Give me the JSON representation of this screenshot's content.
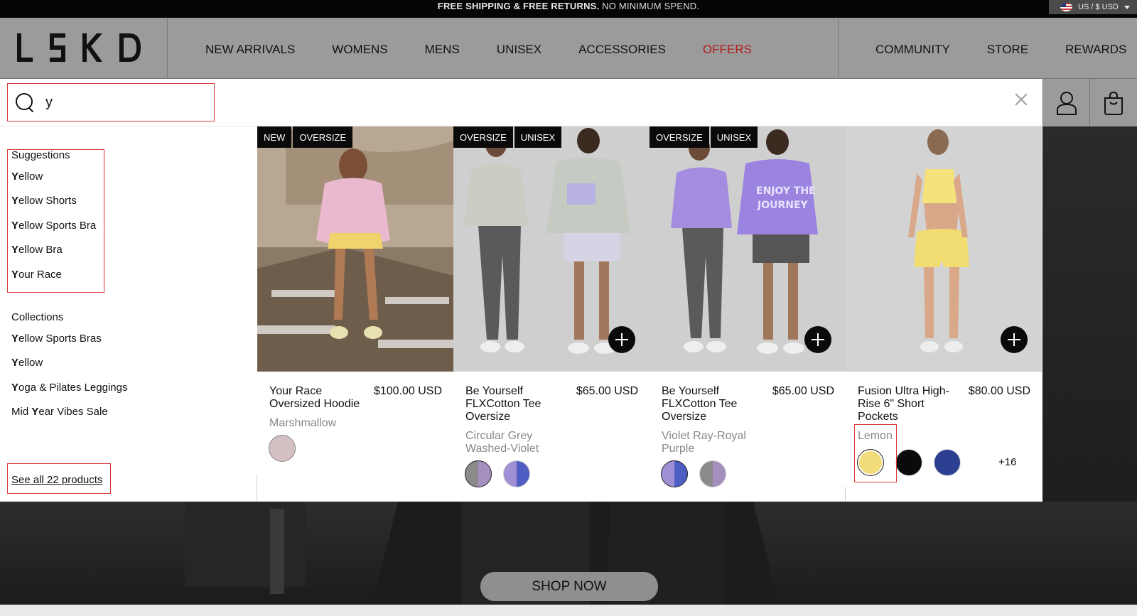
{
  "announcement": {
    "bold": "FREE SHIPPING & FREE RETURNS.",
    "rest": " NO MINIMUM SPEND."
  },
  "locale": "US / $ USD",
  "brand": "LSKD",
  "nav": [
    "NEW ARRIVALS",
    "WOMENS",
    "MENS",
    "UNISEX",
    "ACCESSORIES",
    "OFFERS"
  ],
  "right_nav": [
    "COMMUNITY",
    "STORE",
    "REWARDS"
  ],
  "search": {
    "value": "y",
    "placeholder": ""
  },
  "suggestions": {
    "title": "Suggestions",
    "items": [
      {
        "first": "Y",
        "rest": "ellow"
      },
      {
        "first": "Y",
        "rest": "ellow Shorts"
      },
      {
        "first": "Y",
        "rest": "ellow Sports Bra"
      },
      {
        "first": "Y",
        "rest": "ellow Bra"
      },
      {
        "first": "Y",
        "rest": "our Race"
      }
    ]
  },
  "collections": {
    "title": "Collections",
    "items": [
      {
        "pre": "",
        "first": "Y",
        "rest": "ellow Sports Bras"
      },
      {
        "pre": "",
        "first": "Y",
        "rest": "ellow"
      },
      {
        "pre": "",
        "first": "Y",
        "rest": "oga & Pilates Leggings"
      },
      {
        "pre": "Mid ",
        "first": "Y",
        "rest": "ear Vibes Sale"
      }
    ]
  },
  "see_all": "See all 22 products",
  "products": [
    {
      "badges": [
        "NEW",
        "OVERSIZE"
      ],
      "name": "Your Race Oversized Hoodie",
      "price": "$100.00 USD",
      "color": "Marshmallow",
      "swatches": [
        "#d4c0c2"
      ],
      "more": ""
    },
    {
      "badges": [
        "OVERSIZE",
        "UNISEX"
      ],
      "name": "Be Yourself FLXCotton Tee Oversize",
      "price": "$65.00 USD",
      "color": "Circular Grey Washed-Violet",
      "swatches": [
        "grey-violet",
        "violet-blue"
      ],
      "more": ""
    },
    {
      "badges": [
        "OVERSIZE",
        "UNISEX"
      ],
      "name": "Be Yourself FLXCotton Tee Oversize",
      "price": "$65.00 USD",
      "color": "Violet Ray-Royal Purple",
      "swatches": [
        "violet-blue",
        "grey-violet"
      ],
      "more": ""
    },
    {
      "badges": [],
      "name": "Fusion Ultra High-Rise 6\" Short Pockets",
      "price": "$80.00 USD",
      "color": "Lemon",
      "swatches": [
        "#f3dc7c",
        "#0a0a0a",
        "#2c3f91"
      ],
      "more": "+16"
    }
  ],
  "hero": {
    "cta": "SHOP NOW"
  },
  "colors": {
    "offers": "#b31a1a",
    "highlight": "#d63a3a"
  }
}
